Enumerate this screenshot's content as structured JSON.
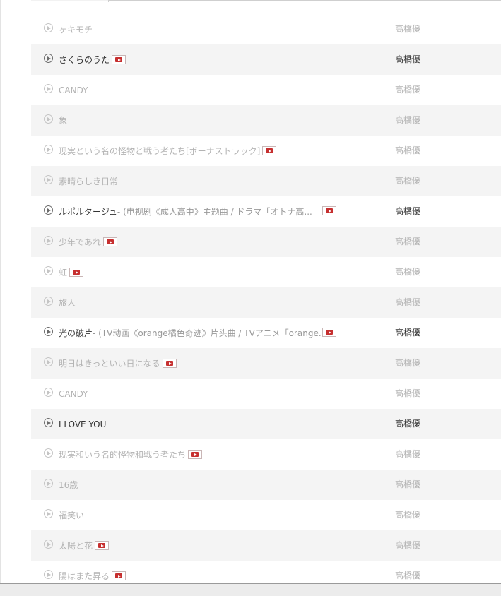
{
  "songs": [
    {
      "title": "ヶキモチ",
      "alias": "",
      "artist": "高橋優",
      "album_fragment": "《",
      "mv": false,
      "mv_end": false,
      "active": false
    },
    {
      "title": "さくらのうた",
      "alias": "",
      "artist": "高橋優",
      "album_fragment": "《",
      "mv": true,
      "mv_end": false,
      "active": true
    },
    {
      "title": "CANDY",
      "alias": "",
      "artist": "高橋優",
      "album_fragment": "《",
      "mv": false,
      "mv_end": false,
      "active": false
    },
    {
      "title": "象",
      "alias": "",
      "artist": "高橋優",
      "album_fragment": "《",
      "mv": false,
      "mv_end": false,
      "active": false
    },
    {
      "title": "现実という名の怪物と戦う者たち[ボーナストラック]",
      "alias": "",
      "artist": "高橋優",
      "album_fragment": "《",
      "mv": true,
      "mv_end": false,
      "active": false
    },
    {
      "title": "素晴らしき日常",
      "alias": "",
      "artist": "高橋優",
      "album_fragment": "《",
      "mv": false,
      "mv_end": false,
      "active": false
    },
    {
      "title": "ルポルタージュ",
      "alias": " - (电视剧《成人高中》主题曲 / ドラマ「オトナ高...",
      "artist": "高橋優",
      "album_fragment": "《",
      "mv": true,
      "mv_end": true,
      "active": true
    },
    {
      "title": "少年であれ",
      "alias": "",
      "artist": "高橋優",
      "album_fragment": "《",
      "mv": true,
      "mv_end": false,
      "active": false
    },
    {
      "title": "虹",
      "alias": "",
      "artist": "高橋優",
      "album_fragment": "《",
      "mv": true,
      "mv_end": false,
      "active": false
    },
    {
      "title": "旅人",
      "alias": "",
      "artist": "高橋優",
      "album_fragment": "《",
      "mv": false,
      "mv_end": false,
      "active": false
    },
    {
      "title": "光の破片",
      "alias": " - (TV动画《orange橘色奇迹》片头曲 / TVアニメ「orange...",
      "artist": "高橋優",
      "album_fragment": "《",
      "mv": true,
      "mv_end": true,
      "active": true
    },
    {
      "title": "明日はきっといい日になる",
      "alias": "",
      "artist": "高橋優",
      "album_fragment": "《",
      "mv": true,
      "mv_end": false,
      "active": false
    },
    {
      "title": "CANDY",
      "alias": "",
      "artist": "高橋優",
      "album_fragment": "《",
      "mv": false,
      "mv_end": false,
      "active": false
    },
    {
      "title": "I LOVE YOU",
      "alias": "",
      "artist": "高橋優",
      "album_fragment": "《",
      "mv": false,
      "mv_end": false,
      "active": true
    },
    {
      "title": "现実和いう名的怪物和戦う者たち",
      "alias": "",
      "artist": "高橋優",
      "album_fragment": "《",
      "mv": true,
      "mv_end": false,
      "active": false
    },
    {
      "title": "16歳",
      "alias": "",
      "artist": "高橋優",
      "album_fragment": "《",
      "mv": false,
      "mv_end": false,
      "active": false
    },
    {
      "title": "福笑い",
      "alias": "",
      "artist": "高橋優",
      "album_fragment": "《",
      "mv": false,
      "mv_end": false,
      "active": false
    },
    {
      "title": "太陽と花",
      "alias": "",
      "artist": "高橋優",
      "album_fragment": "《",
      "mv": true,
      "mv_end": false,
      "active": false
    },
    {
      "title": "陽はまた昇る",
      "alias": "",
      "artist": "高橋優",
      "album_fragment": "《",
      "mv": true,
      "mv_end": false,
      "active": false
    }
  ]
}
